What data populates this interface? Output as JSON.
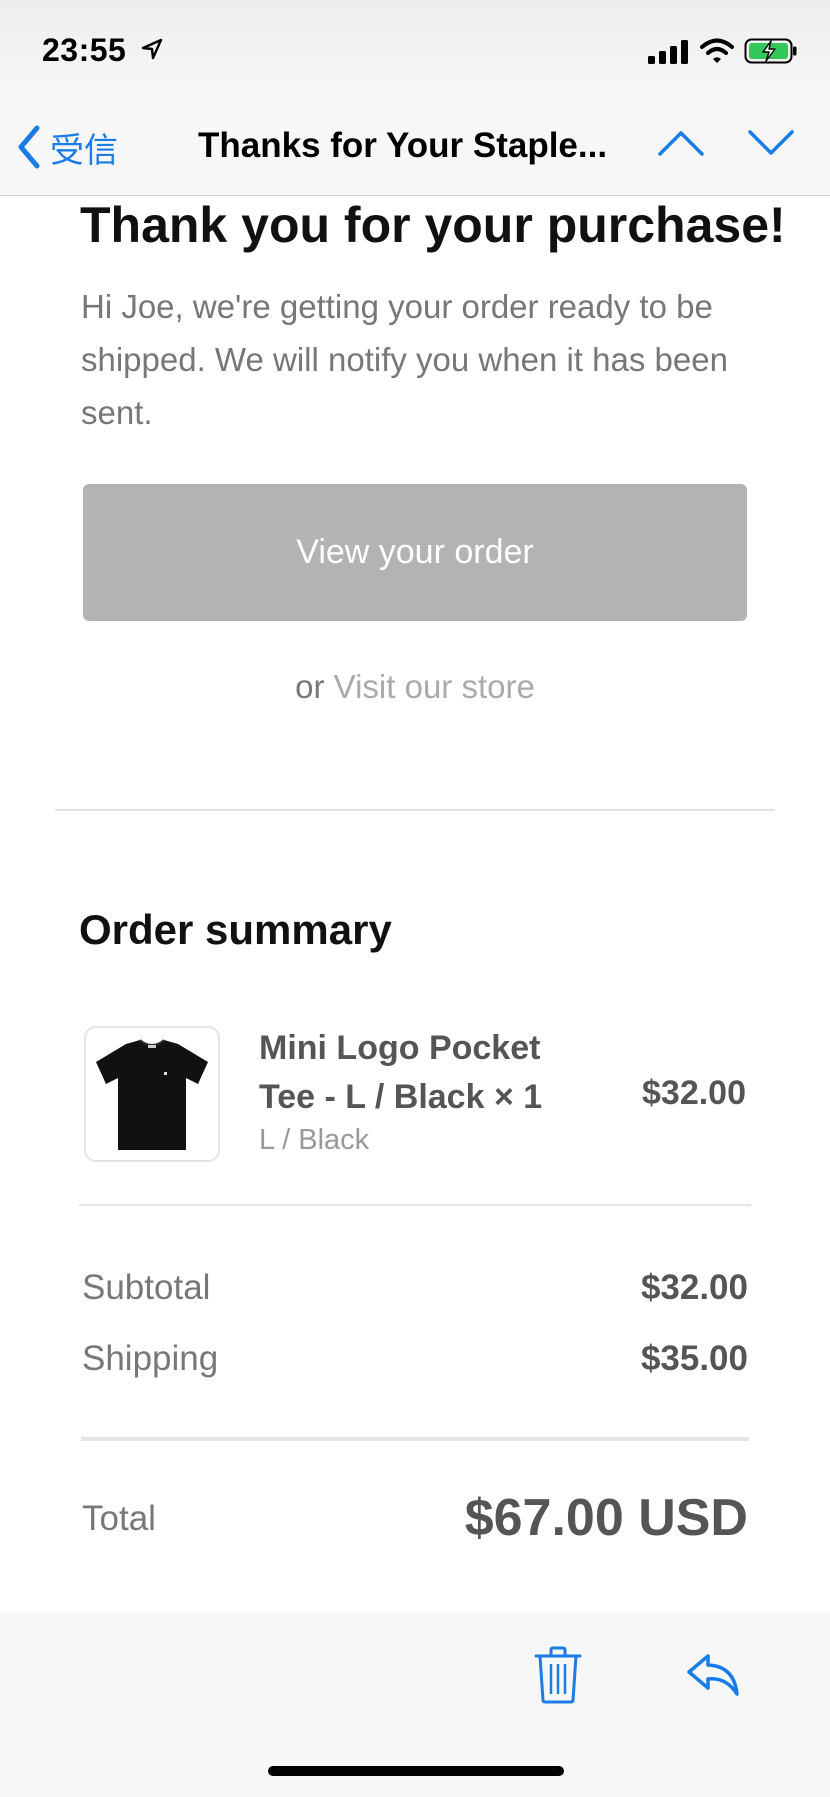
{
  "status_bar": {
    "time": "23:55"
  },
  "nav": {
    "back_label": "受信",
    "title": "Thanks for Your Staple..."
  },
  "email": {
    "headline": "Thank you for your purchase!",
    "intro": "Hi Joe, we're getting your order ready to be shipped. We will notify you when it has been sent.",
    "view_order_label": "View your order",
    "or_text": "or ",
    "visit_store_label": "Visit our store"
  },
  "summary": {
    "title": "Order summary",
    "item": {
      "name": "Mini Logo Pocket Tee - L / Black × 1",
      "variant": "L / Black",
      "price": "$32.00"
    },
    "subtotal_label": "Subtotal",
    "subtotal_value": "$32.00",
    "shipping_label": "Shipping",
    "shipping_value": "$35.00",
    "total_label": "Total",
    "total_value": "$67.00 USD"
  },
  "colors": {
    "accent": "#1a7ce6",
    "button_gray": "#b3b3b3",
    "battery_green": "#34c759"
  },
  "icons": {
    "back": "chevron-left-icon",
    "prev_message": "chevron-up-icon",
    "next_message": "chevron-down-icon",
    "delete": "trash-icon",
    "reply": "reply-icon"
  }
}
